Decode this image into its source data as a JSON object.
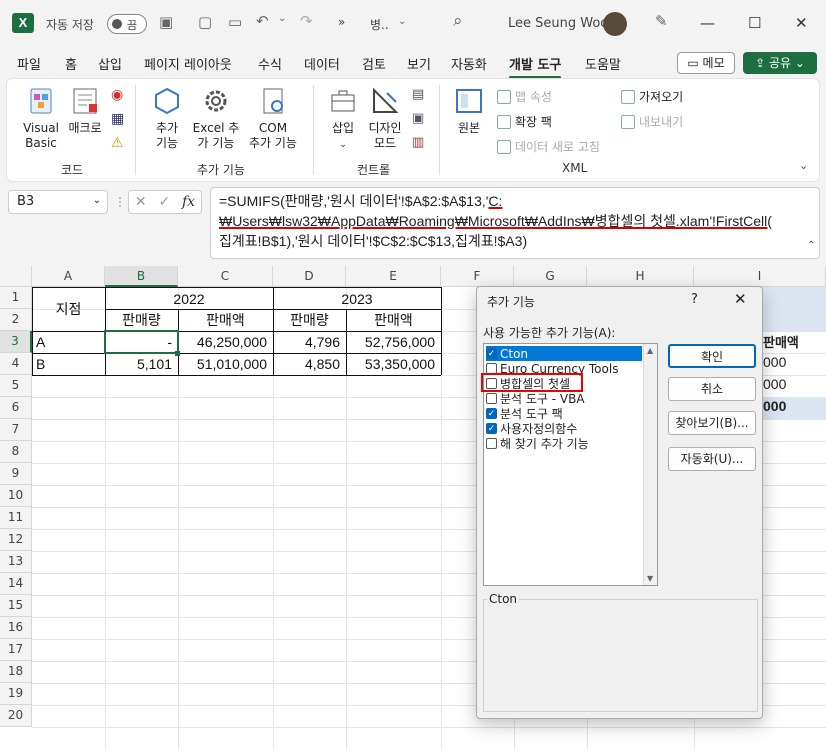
{
  "titlebar": {
    "autosave_label": "자동 저장",
    "toggle_state": "끔",
    "filename": "병..",
    "more": "»",
    "user_name": "Lee Seung Woo",
    "minimize": "—",
    "maximize": "☐",
    "close": "✕"
  },
  "menu": {
    "items": [
      "파일",
      "홈",
      "삽입",
      "페이지 레이아웃",
      "수식",
      "데이터",
      "검토",
      "보기",
      "자동화",
      "개발 도구",
      "도움말"
    ],
    "memo_label": "메모",
    "share_label": "공유"
  },
  "ribbon": {
    "visual_basic": "Visual\nBasic",
    "macro": "매크로",
    "group_code": "코드",
    "addins": "추가\n기능",
    "excel_addins": "Excel 추\n가 기능",
    "com_addins": "COM\n추가 기능",
    "group_addins": "추가 기능",
    "insert": "삽입",
    "design_mode": "디자인\n모드",
    "group_controls": "컨트롤",
    "source": "원본",
    "map_props": "맵 속성",
    "expansion_pack": "확장 팩",
    "refresh_data": "데이터 새로 고침",
    "import": "가져오기",
    "export": "내보내기",
    "group_xml": "XML"
  },
  "formula_bar": {
    "name_box": "B3",
    "fx": "fx",
    "line1_a": "=SUMIFS(판매량,'원시 데이터'!$A$2:$A$13,'",
    "line1_b": "C:",
    "line2": "₩Users₩lsw32₩AppData₩Roaming₩Microsoft₩AddIns₩병합셀의 첫셀.xlam'!FirstCell(",
    "line3": "집계표!B$1),'원시 데이터'!$C$2:$C$13,집계표!$A3)"
  },
  "sheet": {
    "columns": [
      "A",
      "B",
      "C",
      "D",
      "E",
      "F",
      "G",
      "H",
      "I"
    ],
    "rows": [
      "1",
      "2",
      "3",
      "4",
      "5",
      "6",
      "7",
      "8",
      "9",
      "10",
      "11",
      "12",
      "13",
      "14",
      "15",
      "16",
      "17",
      "18",
      "19",
      "20"
    ],
    "header_region": "지점",
    "year1": "2022",
    "year2": "2023",
    "sub_qty": "판매량",
    "sub_amt": "판매액",
    "row3": [
      "A",
      "-",
      "46,250,000",
      "4,796",
      "52,756,000"
    ],
    "row4": [
      "B",
      "5,101",
      "51,010,000",
      "4,850",
      "53,350,000"
    ],
    "behind_i2": "판매액",
    "behind_i3": "000",
    "behind_i4": "000",
    "behind_i6": "000"
  },
  "dialog": {
    "title": "추가 기능",
    "help": "?",
    "close": "✕",
    "list_label": "사용 가능한 추가 기능(A):",
    "items": [
      {
        "label": "Cton",
        "checked": true
      },
      {
        "label": "Euro Currency Tools",
        "checked": false
      },
      {
        "label": "병합셀의 첫셀",
        "checked": false
      },
      {
        "label": "분석 도구 - VBA",
        "checked": false
      },
      {
        "label": "분석 도구 팩",
        "checked": true
      },
      {
        "label": "사용자정의함수",
        "checked": true
      },
      {
        "label": "해 찾기 추가 기능",
        "checked": false
      }
    ],
    "ok": "확인",
    "cancel": "취소",
    "browse": "찾아보기(B)...",
    "automation": "자동화(U)...",
    "description_title": "Cton"
  }
}
